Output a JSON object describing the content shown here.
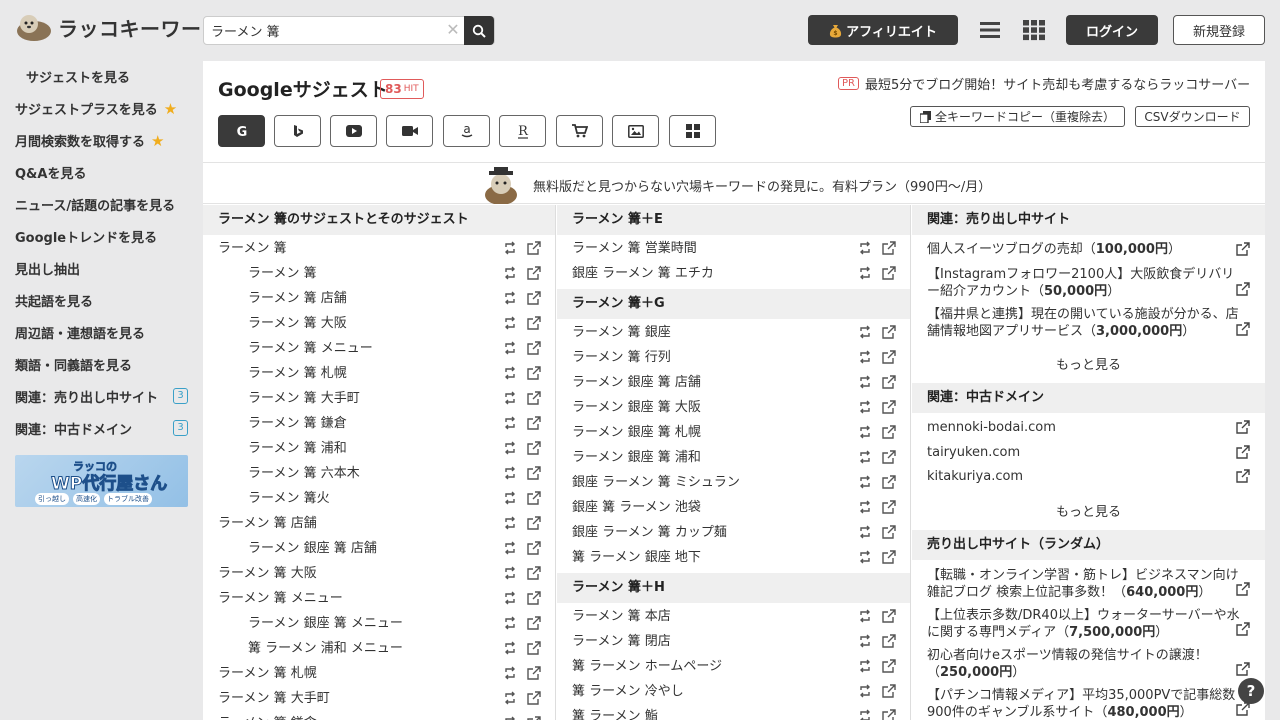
{
  "header": {
    "logo_text": "ラッコキーワード",
    "search_value": "ラーメン 篝",
    "affiliate_label": "アフィリエイト",
    "login_label": "ログイン",
    "register_label": "新規登録"
  },
  "sidebar": {
    "items": [
      {
        "label": "サジェストを見る"
      },
      {
        "label": "サジェストプラスを見る"
      },
      {
        "label": "月間検索数を取得する"
      },
      {
        "label": "Q&Aを見る"
      },
      {
        "label": "ニュース/話題の記事を見る"
      },
      {
        "label": "Googleトレンドを見る"
      },
      {
        "label": "見出し抽出"
      },
      {
        "label": "共起語を見る"
      },
      {
        "label": "周辺語・連想語を見る"
      },
      {
        "label": "類語・同義語を見る"
      },
      {
        "label": "関連：売り出し中サイト",
        "badge": "3"
      },
      {
        "label": "関連：中古ドメイン",
        "badge": "3"
      }
    ],
    "banner_title": "WP代行屋さん",
    "banner_small": "ラッコの",
    "banner_tags": [
      "引っ越し",
      "高速化",
      "トラブル改善"
    ]
  },
  "main": {
    "title": "Googleサジェスト",
    "hit_count": "83",
    "hit_label": "HIT",
    "pr_tag": "PR",
    "pr_text": "最短5分でブログ開始！サイト売却も考慮するならラッコサーバー",
    "copy_label": "全キーワードコピー（重複除去）",
    "csv_label": "CSVダウンロード",
    "promo_text": "無料版だと見つからない穴場キーワードの発見に。有料プラン（990円〜/月）"
  },
  "col1": {
    "header": "ラーメン 篝のサジェストとそのサジェスト",
    "rows": [
      {
        "text": "ラーメン 篝",
        "sub": false
      },
      {
        "text": "ラーメン 篝",
        "sub": true
      },
      {
        "text": "ラーメン 篝 店舗",
        "sub": true
      },
      {
        "text": "ラーメン 篝 大阪",
        "sub": true
      },
      {
        "text": "ラーメン 篝 メニュー",
        "sub": true
      },
      {
        "text": "ラーメン 篝 札幌",
        "sub": true
      },
      {
        "text": "ラーメン 篝 大手町",
        "sub": true
      },
      {
        "text": "ラーメン 篝 鎌倉",
        "sub": true
      },
      {
        "text": "ラーメン 篝 浦和",
        "sub": true
      },
      {
        "text": "ラーメン 篝 六本木",
        "sub": true
      },
      {
        "text": "ラーメン 篝火",
        "sub": true
      },
      {
        "text": "ラーメン 篝 店舗",
        "sub": false
      },
      {
        "text": "ラーメン 銀座 篝 店舗",
        "sub": true
      },
      {
        "text": "ラーメン 篝 大阪",
        "sub": false
      },
      {
        "text": "ラーメン 篝 メニュー",
        "sub": false
      },
      {
        "text": "ラーメン 銀座 篝 メニュー",
        "sub": true
      },
      {
        "text": "篝 ラーメン 浦和 メニュー",
        "sub": true
      },
      {
        "text": "ラーメン 篝 札幌",
        "sub": false
      },
      {
        "text": "ラーメン 篝 大手町",
        "sub": false
      },
      {
        "text": "ラーメン 篝 鎌倉",
        "sub": false
      }
    ]
  },
  "col2": {
    "sections": [
      {
        "header": "ラーメン 篝＋E",
        "rows": [
          "ラーメン 篝 営業時間",
          "銀座 ラーメン 篝 エチカ"
        ]
      },
      {
        "header": "ラーメン 篝＋G",
        "rows": [
          "ラーメン 篝 銀座",
          "ラーメン 篝 行列",
          "ラーメン 銀座 篝 店舗",
          "ラーメン 銀座 篝 大阪",
          "ラーメン 銀座 篝 札幌",
          "ラーメン 銀座 篝 浦和",
          "銀座 ラーメン 篝 ミシュラン",
          "銀座 篝 ラーメン 池袋",
          "銀座 ラーメン 篝 カップ麺",
          "篝 ラーメン 銀座 地下"
        ]
      },
      {
        "header": "ラーメン 篝＋H",
        "rows": [
          "ラーメン 篝 本店",
          "ラーメン 篝 閉店",
          "篝 ラーメン ホームページ",
          "篝 ラーメン 冷やし",
          "篝 ラーメン 鮨"
        ]
      }
    ]
  },
  "col3": {
    "sale_header": "関連：売り出し中サイト",
    "sale_items": [
      {
        "text": "個人スイーツブログの売却（",
        "price": "100,000円",
        "tail": "）"
      },
      {
        "text": "【Instagramフォロワー2100人】大阪飲食デリバリー紹介アカウント（",
        "price": "50,000円",
        "tail": "）"
      },
      {
        "text": "【福井県と連携】現在の開いている施設が分かる、店舗情報地図アプリサービス（",
        "price": "3,000,000円",
        "tail": "）"
      }
    ],
    "more1": "もっと見る",
    "domain_header": "関連：中古ドメイン",
    "domains": [
      "mennoki-bodai.com",
      "tairyuken.com",
      "kitakuriya.com"
    ],
    "more2": "もっと見る",
    "random_header": "売り出し中サイト（ランダム）",
    "random_items": [
      {
        "text": "【転職・オンライン学習・筋トレ】ビジネスマン向け雑記ブログ 検索上位記事多数！（",
        "price": "640,000円",
        "tail": "）"
      },
      {
        "text": "【上位表示多数/DR40以上】ウォーターサーバーや水に関する専門メディア（",
        "price": "7,500,000円",
        "tail": "）"
      },
      {
        "text": "初心者向けeスポーツ情報の発信サイトの譲渡！（",
        "price": "250,000円",
        "tail": "）"
      },
      {
        "text": "【パチンコ情報メディア】平均35,000PVで記事総数900件のギャンブル系サイト（",
        "price": "480,000円",
        "tail": "）"
      }
    ]
  },
  "help_label": "?"
}
